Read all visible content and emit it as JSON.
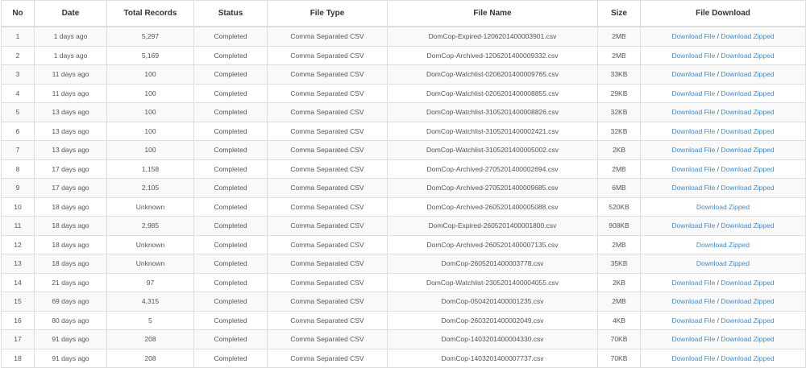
{
  "headers": [
    "No",
    "Date",
    "Total Records",
    "Status",
    "File Type",
    "File Name",
    "Size",
    "File Download"
  ],
  "link_labels": {
    "file": "Download File",
    "separator": " / ",
    "zipped": "Download Zipped"
  },
  "colors": {
    "link": "#428bca",
    "text": "#555555",
    "stripe": "#f9f9f9",
    "border": "#dddddd"
  },
  "rows": [
    {
      "no": "1",
      "date": "1 days ago",
      "records": "5,297",
      "status": "Completed",
      "type": "Comma Separated CSV",
      "name": "DomCop-Expired-1206201400003901.csv",
      "size": "2MB",
      "file_link": true
    },
    {
      "no": "2",
      "date": "1 days ago",
      "records": "5,169",
      "status": "Completed",
      "type": "Comma Separated CSV",
      "name": "DomCop-Archived-1206201400009332.csv",
      "size": "2MB",
      "file_link": true
    },
    {
      "no": "3",
      "date": "11 days ago",
      "records": "100",
      "status": "Completed",
      "type": "Comma Separated CSV",
      "name": "DomCop-Watchlist-0206201400009765.csv",
      "size": "33KB",
      "file_link": true
    },
    {
      "no": "4",
      "date": "11 days ago",
      "records": "100",
      "status": "Completed",
      "type": "Comma Separated CSV",
      "name": "DomCop-Watchlist-0206201400008855.csv",
      "size": "29KB",
      "file_link": true
    },
    {
      "no": "5",
      "date": "13 days ago",
      "records": "100",
      "status": "Completed",
      "type": "Comma Separated CSV",
      "name": "DomCop-Watchlist-3105201400008826.csv",
      "size": "32KB",
      "file_link": true
    },
    {
      "no": "6",
      "date": "13 days ago",
      "records": "100",
      "status": "Completed",
      "type": "Comma Separated CSV",
      "name": "DomCop-Watchlist-3105201400002421.csv",
      "size": "32KB",
      "file_link": true
    },
    {
      "no": "7",
      "date": "13 days ago",
      "records": "100",
      "status": "Completed",
      "type": "Comma Separated CSV",
      "name": "DomCop-Watchlist-3105201400005002.csv",
      "size": "2KB",
      "file_link": true
    },
    {
      "no": "8",
      "date": "17 days ago",
      "records": "1,158",
      "status": "Completed",
      "type": "Comma Separated CSV",
      "name": "DomCop-Archived-2705201400002694.csv",
      "size": "2MB",
      "file_link": true
    },
    {
      "no": "9",
      "date": "17 days ago",
      "records": "2,105",
      "status": "Completed",
      "type": "Comma Separated CSV",
      "name": "DomCop-Archived-2705201400009685.csv",
      "size": "6MB",
      "file_link": true
    },
    {
      "no": "10",
      "date": "18 days ago",
      "records": "Unknown",
      "status": "Completed",
      "type": "Comma Separated CSV",
      "name": "DomCop-Archived-2605201400005088.csv",
      "size": "520KB",
      "file_link": false
    },
    {
      "no": "11",
      "date": "18 days ago",
      "records": "2,985",
      "status": "Completed",
      "type": "Comma Separated CSV",
      "name": "DomCop-Expired-2605201400001800.csv",
      "size": "908KB",
      "file_link": true
    },
    {
      "no": "12",
      "date": "18 days ago",
      "records": "Unknown",
      "status": "Completed",
      "type": "Comma Separated CSV",
      "name": "DomCop-Archived-2605201400007135.csv",
      "size": "2MB",
      "file_link": false
    },
    {
      "no": "13",
      "date": "18 days ago",
      "records": "Unknown",
      "status": "Completed",
      "type": "Comma Separated CSV",
      "name": "DomCop-2605201400003778.csv",
      "size": "35KB",
      "file_link": false
    },
    {
      "no": "14",
      "date": "21 days ago",
      "records": "97",
      "status": "Completed",
      "type": "Comma Separated CSV",
      "name": "DomCop-Watchlist-2305201400004055.csv",
      "size": "2KB",
      "file_link": true
    },
    {
      "no": "15",
      "date": "69 days ago",
      "records": "4,315",
      "status": "Completed",
      "type": "Comma Separated CSV",
      "name": "DomCop-0504201400001235.csv",
      "size": "2MB",
      "file_link": true
    },
    {
      "no": "16",
      "date": "80 days ago",
      "records": "5",
      "status": "Completed",
      "type": "Comma Separated CSV",
      "name": "DomCop-2603201400002049.csv",
      "size": "4KB",
      "file_link": true
    },
    {
      "no": "17",
      "date": "91 days ago",
      "records": "208",
      "status": "Completed",
      "type": "Comma Separated CSV",
      "name": "DomCop-1403201400004330.csv",
      "size": "70KB",
      "file_link": true
    },
    {
      "no": "18",
      "date": "91 days ago",
      "records": "208",
      "status": "Completed",
      "type": "Comma Separated CSV",
      "name": "DomCop-1403201400007737.csv",
      "size": "70KB",
      "file_link": true
    }
  ]
}
